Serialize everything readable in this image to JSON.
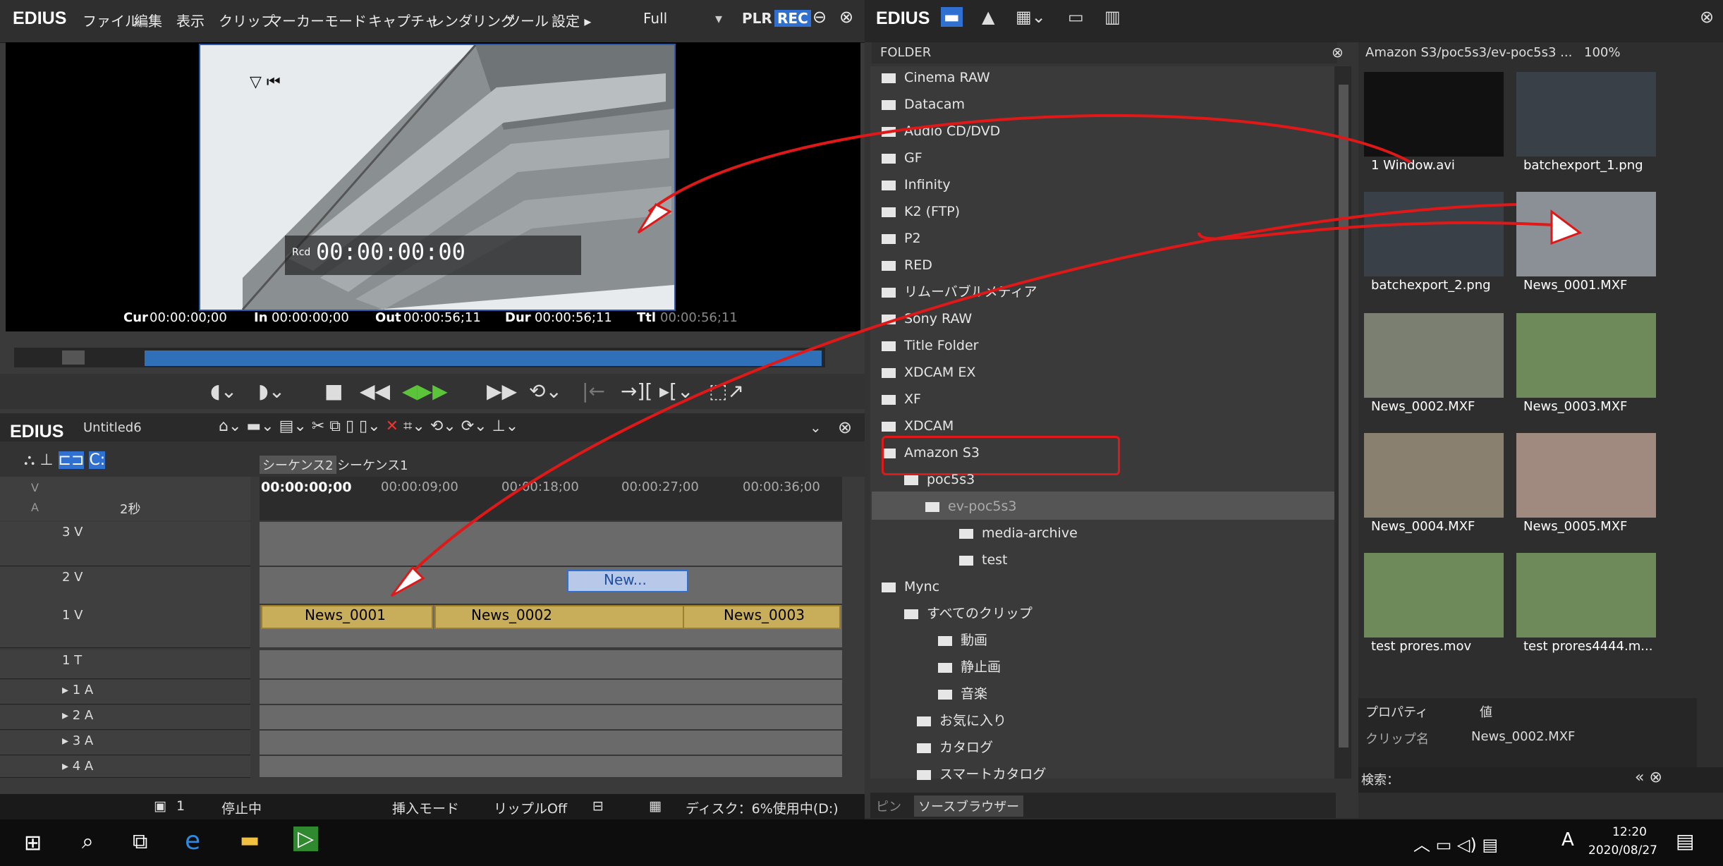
{
  "menubar": {
    "app": "EDIUS",
    "items": [
      "ファイル",
      "編集",
      "表示",
      "クリップ",
      "マーカー",
      "モード",
      "キャプチャ",
      "レンダリング",
      "ツール",
      "設定 ▸"
    ],
    "mode": "Full",
    "plr": "PLR",
    "rec": "REC"
  },
  "viewer": {
    "rec_tc": "00:00:00:00",
    "rcd": "Rcd"
  },
  "timecodes": {
    "cur_label": "Cur",
    "cur": "00:00:00;00",
    "in_label": "In",
    "in": "00:00:00;00",
    "out_label": "Out",
    "out": "00:00:56;11",
    "dur_label": "Dur",
    "dur": "00:00:56;11",
    "ttl_label": "Ttl",
    "ttl": "00:00:56;11"
  },
  "timeline": {
    "title": "EDIUS",
    "project": "Untitled6",
    "tabs": [
      "シーケンス2",
      "シーケンス1"
    ],
    "zoom": "2秒",
    "ruler": [
      "00:00:00;00",
      "00:00:09;00",
      "00:00:18;00",
      "00:00:27;00",
      "00:00:36;00"
    ],
    "tracks": [
      {
        "label": "3 V"
      },
      {
        "label": "2 V"
      },
      {
        "label": "1 V"
      },
      {
        "label": "1 T"
      },
      {
        "label": "▸ 1 A"
      },
      {
        "label": "▸ 2 A"
      },
      {
        "label": "▸ 3 A"
      },
      {
        "label": "▸ 4 A"
      }
    ],
    "clips": {
      "c2v": "New...",
      "c1": "News_0001",
      "c2": "News_0002",
      "c3": "News_0003"
    }
  },
  "status": {
    "num": "1",
    "state": "停止中",
    "insert": "挿入モード",
    "ripple": "リップルOff",
    "disk": "ディスク：6%使用中(D:)"
  },
  "browser": {
    "title": "EDIUS",
    "folder_header": "FOLDER",
    "path": "Amazon S3/poc5s3/ev-poc5s3 ...",
    "zoom": "100%",
    "folders": [
      "Cinema RAW",
      "Datacam",
      "Audio CD/DVD",
      "GF",
      "Infinity",
      "K2 (FTP)",
      "P2",
      "RED",
      "リムーバブルメディア",
      "Sony RAW",
      "Title Folder",
      "XDCAM EX",
      "XF",
      "XDCAM",
      "Amazon S3",
      "poc5s3",
      "ev-poc5s3",
      "media-archive",
      "test",
      "Mync",
      "すべてのクリップ",
      "動画",
      "静止画",
      "音楽",
      "お気に入り",
      "カタログ",
      "スマートカタログ"
    ],
    "thumbs": [
      "1 Window.avi",
      "batchexport_1.png",
      "batchexport_2.png",
      "News_0001.MXF",
      "News_0002.MXF",
      "News_0003.MXF",
      "News_0004.MXF",
      "News_0005.MXF",
      "test prores.mov",
      "test prores4444.m..."
    ],
    "prop_header": "プロパティ",
    "value_header": "値",
    "clip_name_label": "クリップ名",
    "clip_name": "News_0002.MXF",
    "search_label": "検索：",
    "tab_pin": "ピン",
    "tab_source": "ソースブラウザー"
  },
  "taskbar": {
    "time": "12:20",
    "date": "2020/08/27",
    "ime": "A"
  }
}
